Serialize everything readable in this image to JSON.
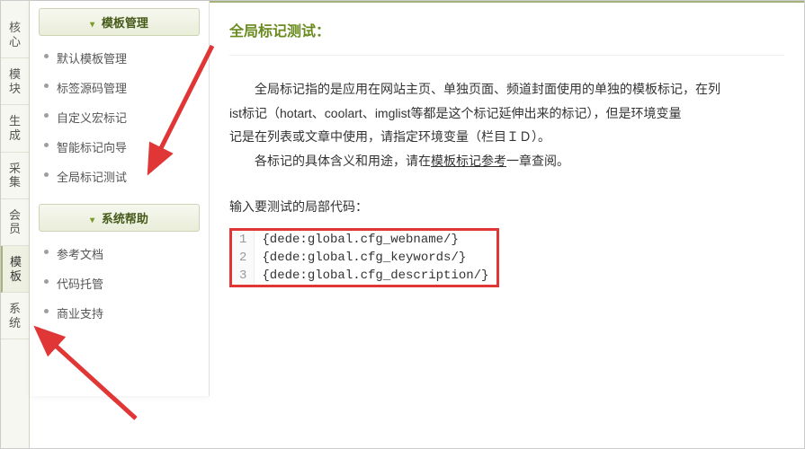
{
  "vtabs": [
    "核心",
    "模块",
    "生成",
    "采集",
    "会员",
    "模板",
    "系统"
  ],
  "vtabs_active_index": 5,
  "sidebar": {
    "groups": [
      {
        "title": "模板管理",
        "items": [
          "默认模板管理",
          "标签源码管理",
          "自定义宏标记",
          "智能标记向导",
          "全局标记测试"
        ]
      },
      {
        "title": "系统帮助",
        "items": [
          "参考文档",
          "代码托管",
          "商业支持"
        ]
      }
    ]
  },
  "main": {
    "title": "全局标记测试：",
    "desc_line1_prefix": "全局标记指的是应用在网站主页、单独页面、频道封面使用的单独的模板标记，在列",
    "desc_line2": "ist标记（hotart、coolart、imglist等都是这个标记延伸出来的标记），但是环境变量",
    "desc_line3": "记是在列表或文章中使用，请指定环境变量（栏目ＩＤ）。",
    "desc_line4_prefix": "各标记的具体含义和用途，请在",
    "desc_link": "模板标记参考",
    "desc_line4_suffix": "一章查阅。",
    "input_label": "输入要测试的局部代码：",
    "code": [
      "{dede:global.cfg_webname/}",
      "{dede:global.cfg_keywords/}",
      "{dede:global.cfg_description/}"
    ]
  }
}
